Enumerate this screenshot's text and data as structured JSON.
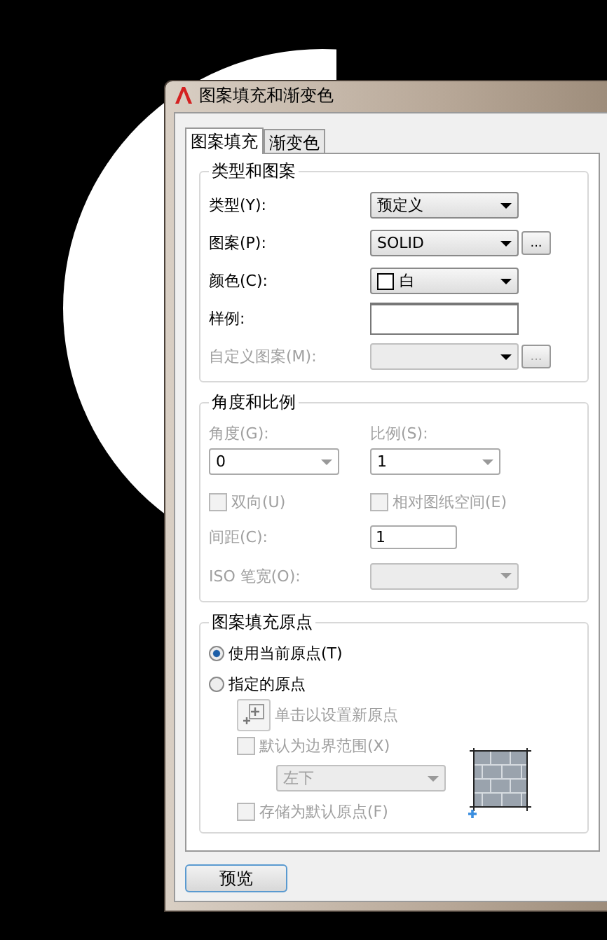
{
  "window": {
    "title": "图案填充和渐变色"
  },
  "tabs": [
    {
      "label": "图案填充",
      "selected": true
    },
    {
      "label": "渐变色",
      "selected": false
    }
  ],
  "type_and_pattern": {
    "title": "类型和图案",
    "rows": [
      {
        "label": "类型(Y):",
        "kind": "dropdown",
        "value": "预定义",
        "disabled": false
      },
      {
        "label": "图案(P):",
        "kind": "dropdown",
        "value": "SOLID",
        "disabled": false,
        "button": "..."
      },
      {
        "label": "颜色(C):",
        "kind": "color",
        "value": "白",
        "color": "#ffffff",
        "disabled": false
      },
      {
        "label": "样例:",
        "kind": "swatch",
        "disabled": false
      },
      {
        "label": "自定义图案(M):",
        "kind": "dropdown",
        "disabled": true,
        "button": "..."
      }
    ]
  },
  "angle_and_scale": {
    "title": "角度和比例",
    "angle": {
      "label": "角度(G):",
      "value": "0",
      "disabled": true
    },
    "scale": {
      "label": "比例(S):",
      "value": "1",
      "disabled": true
    },
    "double": {
      "label": "双向(U)",
      "checked": false,
      "disabled": true
    },
    "relative": {
      "label": "相对图纸空间(E)",
      "checked": false,
      "disabled": true
    },
    "spacing": {
      "label": "间距(C):",
      "value": "1",
      "disabled": true
    },
    "iso": {
      "label": "ISO 笔宽(O):",
      "disabled": true
    }
  },
  "origin": {
    "title": "图案填充原点",
    "options": [
      {
        "label": "使用当前原点(T)",
        "selected": true
      },
      {
        "label": "指定的原点",
        "selected": false
      }
    ],
    "set_new": {
      "label": "单击以设置新原点",
      "disabled": true
    },
    "default_extent": {
      "label": "默认为边界范围(X)",
      "checked": false,
      "disabled": true
    },
    "position": {
      "value": "左下",
      "disabled": true
    },
    "store_default": {
      "label": "存储为默认原点(F)",
      "checked": false,
      "disabled": true
    }
  },
  "preview_button": {
    "label": "预览"
  }
}
